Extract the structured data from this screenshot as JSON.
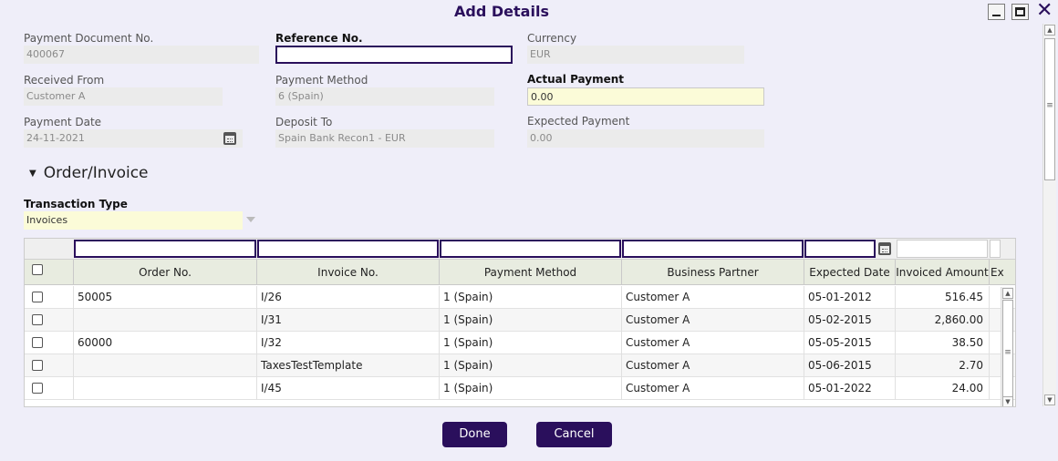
{
  "dialog": {
    "title": "Add Details"
  },
  "form": {
    "payment_document_no": {
      "label": "Payment Document No.",
      "value": "400067"
    },
    "reference_no": {
      "label": "Reference No.",
      "value": ""
    },
    "currency": {
      "label": "Currency",
      "value": "EUR"
    },
    "received_from": {
      "label": "Received From",
      "value": "Customer A"
    },
    "payment_method": {
      "label": "Payment Method",
      "value": "6 (Spain)"
    },
    "actual_payment": {
      "label": "Actual Payment",
      "value": "0.00"
    },
    "payment_date": {
      "label": "Payment Date",
      "value": "24-11-2021"
    },
    "deposit_to": {
      "label": "Deposit To",
      "value": "Spain Bank Recon1 - EUR"
    },
    "expected_payment": {
      "label": "Expected Payment",
      "value": "0.00"
    }
  },
  "section": {
    "title": "Order/Invoice"
  },
  "transaction_type": {
    "label": "Transaction Type",
    "value": "Invoices"
  },
  "grid": {
    "columns": [
      "Order No.",
      "Invoice No.",
      "Payment Method",
      "Business Partner",
      "Expected Date",
      "Invoiced Amount",
      "Ex"
    ],
    "rows": [
      {
        "order": "50005",
        "invoice": "I/26",
        "method": "1 (Spain)",
        "partner": "Customer A",
        "date": "05-01-2012",
        "amount": "516.45"
      },
      {
        "order": "",
        "invoice": "I/31",
        "method": "1 (Spain)",
        "partner": "Customer A",
        "date": "05-02-2015",
        "amount": "2,860.00"
      },
      {
        "order": "60000",
        "invoice": "I/32",
        "method": "1 (Spain)",
        "partner": "Customer A",
        "date": "05-05-2015",
        "amount": "38.50"
      },
      {
        "order": "",
        "invoice": "TaxesTestTemplate",
        "method": "1 (Spain)",
        "partner": "Customer A",
        "date": "05-06-2015",
        "amount": "2.70"
      },
      {
        "order": "",
        "invoice": "I/45",
        "method": "1 (Spain)",
        "partner": "Customer A",
        "date": "05-01-2022",
        "amount": "24.00"
      }
    ]
  },
  "buttons": {
    "done": "Done",
    "cancel": "Cancel"
  },
  "colors": {
    "accent": "#2a0f5c",
    "background": "#efeef9",
    "highlight": "#fbfbd8"
  }
}
